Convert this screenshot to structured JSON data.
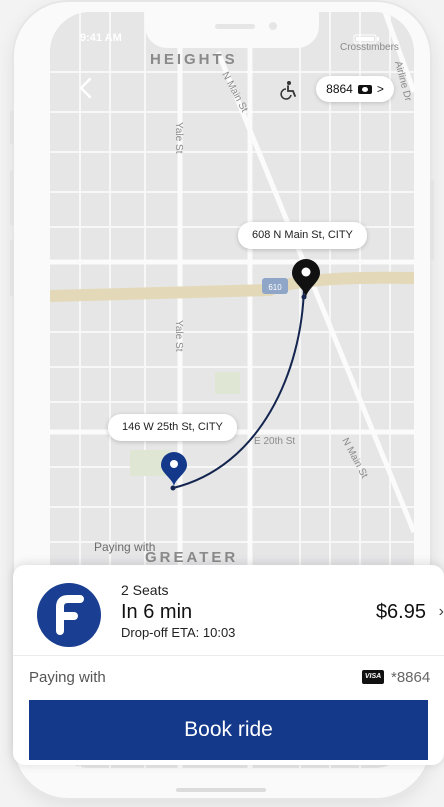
{
  "status_bar": {
    "time": "9:41 AM"
  },
  "map": {
    "labels": {
      "heights": "HEIGHTS",
      "crosstimbers": "Crosstimbers",
      "airline_dr": "Airline Dr",
      "n_main_top": "N Main St",
      "yale_top": "Yale St",
      "yale_mid": "Yale St",
      "e_20th": "E 20th St",
      "n_main_low": "N Main St",
      "greater": "GREATER",
      "interstate": "610",
      "map_paying": "Paying with"
    }
  },
  "header": {
    "fare_pill_number": "8864",
    "fare_pill_chevron": ">"
  },
  "route": {
    "destination_label": "608 N Main St, CITY",
    "origin_label": "146 W 25th St, CITY"
  },
  "ride": {
    "seats": "2 Seats",
    "eta_main": "In 6 min",
    "eta_sub": "Drop-off ETA: 10:03",
    "price": "$6.95",
    "price_chevron": "›"
  },
  "payment": {
    "label": "Paying with",
    "card_brand": "VISA",
    "card_number": "*8864"
  },
  "actions": {
    "book_label": "Book ride"
  },
  "colors": {
    "brand": "#14398a",
    "logo": "#1a3e91",
    "pin_origin": "#14398a",
    "pin_dest": "#111111"
  }
}
